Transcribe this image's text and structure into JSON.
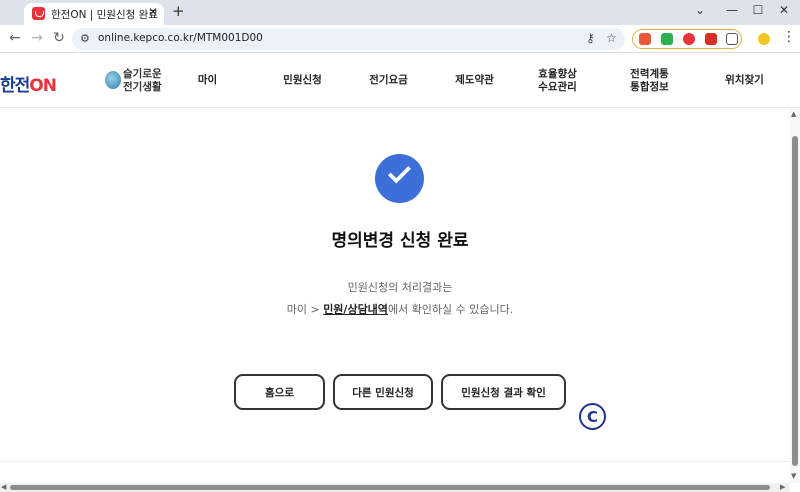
{
  "browser": {
    "tab_title": "한전ON | 민원신청 완료",
    "tab_close": "✕",
    "new_tab": "+",
    "window_controls": {
      "collapse": "⌄",
      "minimize": "—",
      "maximize": "☐",
      "close": "✕"
    },
    "url": "online.kepco.co.kr/MTM001D00",
    "nav": {
      "back": "←",
      "forward": "→",
      "reload": "↻"
    },
    "icons": [
      "site-info-icon",
      "password-key-icon",
      "bookmark-star-icon",
      "extensions-icon",
      "profile-icon",
      "menu-icon"
    ],
    "extension_colors": [
      "#e8573a",
      "#2bb24c",
      "#e8333a",
      "#d93025"
    ]
  },
  "site": {
    "logo_main": "한전",
    "logo_on": "ON",
    "wise_line1": "슬기로운",
    "wise_line2": "전기생활",
    "gnb": [
      {
        "line1": "마이",
        "line2": ""
      },
      {
        "line1": "민원신청",
        "line2": ""
      },
      {
        "line1": "전기요금",
        "line2": ""
      },
      {
        "line1": "제도약관",
        "line2": ""
      },
      {
        "line1": "효율향상",
        "line2": "수요관리"
      },
      {
        "line1": "전력계통",
        "line2": "통합정보"
      },
      {
        "line1": "위치찾기",
        "line2": ""
      }
    ]
  },
  "main": {
    "title": "명의변경 신청 완료",
    "desc_line1": "민원신청의 처리결과는",
    "desc_prefix": "마이 > ",
    "desc_link": "민원/상담내역",
    "desc_suffix": "에서 확인하실 수 있습니다.",
    "buttons": {
      "home": "홈으로",
      "other": "다른 민원신청",
      "result": "민원신청 결과 확인"
    },
    "floating_icon_text": "C"
  },
  "colors": {
    "accent_blue": "#3c6fd8",
    "logo_navy": "#1b3d94",
    "logo_red": "#e8333a"
  }
}
